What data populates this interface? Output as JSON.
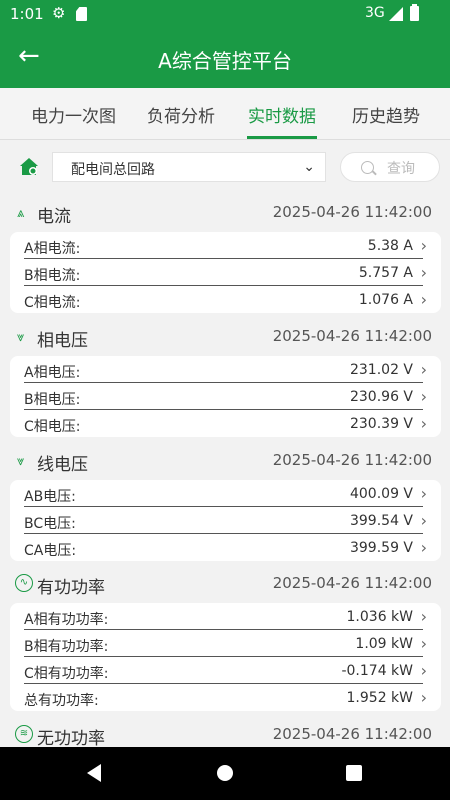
{
  "status_bar": {
    "time": "1:01",
    "network": "3G",
    "icons": [
      "gear-icon",
      "sd-card-icon",
      "signal-icon",
      "battery-icon"
    ]
  },
  "app_bar": {
    "title": "A综合管控平台"
  },
  "tabs": [
    {
      "label": "电力一次图"
    },
    {
      "label": "负荷分析"
    },
    {
      "label": "实时数据",
      "active": true
    },
    {
      "label": "历史趋势"
    }
  ],
  "filter": {
    "selected_circuit": "配电间总回路",
    "search_placeholder": "查询"
  },
  "sections": [
    {
      "title": "电流",
      "timestamp": "2025-04-26 11:42:00",
      "rows": [
        {
          "label": "A相电流:",
          "value": "5.38 A"
        },
        {
          "label": "B相电流:",
          "value": "5.757 A"
        },
        {
          "label": "C相电流:",
          "value": "1.076 A"
        }
      ]
    },
    {
      "title": "相电压",
      "timestamp": "2025-04-26 11:42:00",
      "rows": [
        {
          "label": "A相电压:",
          "value": "231.02 V"
        },
        {
          "label": "B相电压:",
          "value": "230.96 V"
        },
        {
          "label": "C相电压:",
          "value": "230.39 V"
        }
      ]
    },
    {
      "title": "线电压",
      "timestamp": "2025-04-26 11:42:00",
      "rows": [
        {
          "label": "AB电压:",
          "value": "400.09 V"
        },
        {
          "label": "BC电压:",
          "value": "399.54 V"
        },
        {
          "label": "CA电压:",
          "value": "399.59 V"
        }
      ]
    },
    {
      "title": "有功功率",
      "timestamp": "2025-04-26 11:42:00",
      "rows": [
        {
          "label": "A相有功功率:",
          "value": "1.036 kW"
        },
        {
          "label": "B相有功功率:",
          "value": "1.09 kW"
        },
        {
          "label": "C相有功功率:",
          "value": "-0.174 kW"
        },
        {
          "label": "总有功功率:",
          "value": "1.952 kW"
        }
      ]
    },
    {
      "title": "无功功率",
      "timestamp": "2025-04-26 11:42:00",
      "rows": []
    }
  ],
  "colors": {
    "brand_green": "#1a9a45",
    "background": "#f2f2f2"
  }
}
